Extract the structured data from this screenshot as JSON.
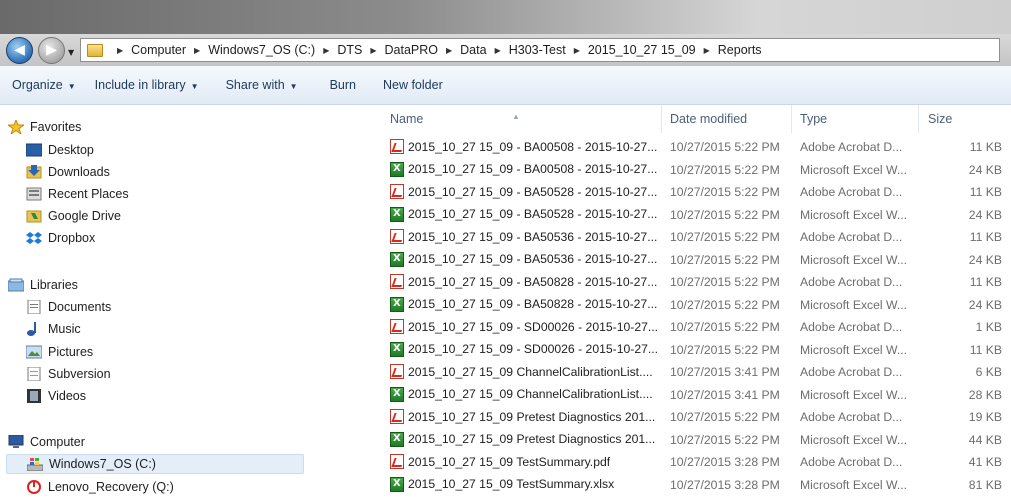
{
  "nav": {
    "back_glyph": "◀",
    "forward_glyph": "▶"
  },
  "address": {
    "crumbs": [
      "Computer",
      "Windows7_OS (C:)",
      "DTS",
      "DataPRO",
      "Data",
      "H303-Test",
      "2015_10_27 15_09",
      "Reports"
    ],
    "separator": "▶"
  },
  "toolbar": {
    "organize": "Organize",
    "include": "Include in library",
    "share": "Share with",
    "burn": "Burn",
    "new_folder": "New folder",
    "dropdown_glyph": "▼"
  },
  "sidebar": {
    "favorites": "Favorites",
    "desktop": "Desktop",
    "downloads": "Downloads",
    "recent": "Recent Places",
    "gdrive": "Google Drive",
    "dropbox": "Dropbox",
    "libraries": "Libraries",
    "documents": "Documents",
    "music": "Music",
    "pictures": "Pictures",
    "subversion": "Subversion",
    "videos": "Videos",
    "computer": "Computer",
    "drive_c": "Windows7_OS (C:)",
    "drive_q": "Lenovo_Recovery (Q:)"
  },
  "columns": {
    "name": "Name",
    "date": "Date modified",
    "type": "Type",
    "size": "Size"
  },
  "files": [
    {
      "name": "2015_10_27 15_09 - BA00508 - 2015-10-27...",
      "date": "10/27/2015 5:22 PM",
      "type": "Adobe Acrobat D...",
      "size": "11 KB",
      "kind": "pdf"
    },
    {
      "name": "2015_10_27 15_09 - BA00508 - 2015-10-27...",
      "date": "10/27/2015 5:22 PM",
      "type": "Microsoft Excel W...",
      "size": "24 KB",
      "kind": "xls"
    },
    {
      "name": "2015_10_27 15_09 - BA50528 - 2015-10-27...",
      "date": "10/27/2015 5:22 PM",
      "type": "Adobe Acrobat D...",
      "size": "11 KB",
      "kind": "pdf"
    },
    {
      "name": "2015_10_27 15_09 - BA50528 - 2015-10-27...",
      "date": "10/27/2015 5:22 PM",
      "type": "Microsoft Excel W...",
      "size": "24 KB",
      "kind": "xls"
    },
    {
      "name": "2015_10_27 15_09 - BA50536 - 2015-10-27...",
      "date": "10/27/2015 5:22 PM",
      "type": "Adobe Acrobat D...",
      "size": "11 KB",
      "kind": "pdf"
    },
    {
      "name": "2015_10_27 15_09 - BA50536 - 2015-10-27...",
      "date": "10/27/2015 5:22 PM",
      "type": "Microsoft Excel W...",
      "size": "24 KB",
      "kind": "xls"
    },
    {
      "name": "2015_10_27 15_09 - BA50828 - 2015-10-27...",
      "date": "10/27/2015 5:22 PM",
      "type": "Adobe Acrobat D...",
      "size": "11 KB",
      "kind": "pdf"
    },
    {
      "name": "2015_10_27 15_09 - BA50828 - 2015-10-27...",
      "date": "10/27/2015 5:22 PM",
      "type": "Microsoft Excel W...",
      "size": "24 KB",
      "kind": "xls"
    },
    {
      "name": "2015_10_27 15_09 - SD00026 - 2015-10-27...",
      "date": "10/27/2015 5:22 PM",
      "type": "Adobe Acrobat D...",
      "size": "1 KB",
      "kind": "pdf"
    },
    {
      "name": "2015_10_27 15_09 - SD00026 - 2015-10-27...",
      "date": "10/27/2015 5:22 PM",
      "type": "Microsoft Excel W...",
      "size": "11 KB",
      "kind": "xls"
    },
    {
      "name": "2015_10_27 15_09 ChannelCalibrationList....",
      "date": "10/27/2015 3:41 PM",
      "type": "Adobe Acrobat D...",
      "size": "6 KB",
      "kind": "pdf"
    },
    {
      "name": "2015_10_27 15_09 ChannelCalibrationList....",
      "date": "10/27/2015 3:41 PM",
      "type": "Microsoft Excel W...",
      "size": "28 KB",
      "kind": "xls"
    },
    {
      "name": "2015_10_27 15_09 Pretest Diagnostics 201...",
      "date": "10/27/2015 5:22 PM",
      "type": "Adobe Acrobat D...",
      "size": "19 KB",
      "kind": "pdf"
    },
    {
      "name": "2015_10_27 15_09 Pretest Diagnostics 201...",
      "date": "10/27/2015 5:22 PM",
      "type": "Microsoft Excel W...",
      "size": "44 KB",
      "kind": "xls"
    },
    {
      "name": "2015_10_27 15_09 TestSummary.pdf",
      "date": "10/27/2015 3:28 PM",
      "type": "Adobe Acrobat D...",
      "size": "41 KB",
      "kind": "pdf"
    },
    {
      "name": "2015_10_27 15_09 TestSummary.xlsx",
      "date": "10/27/2015 3:28 PM",
      "type": "Microsoft Excel W...",
      "size": "81 KB",
      "kind": "xls"
    }
  ]
}
